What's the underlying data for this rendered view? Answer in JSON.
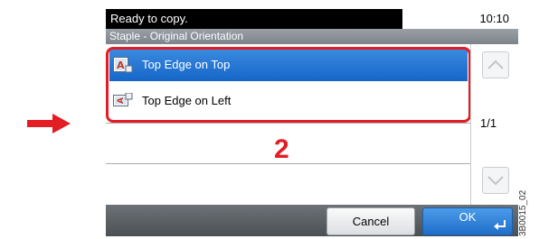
{
  "status": {
    "message": "Ready to copy.",
    "time": "10:10"
  },
  "screen_title": "Staple - Original Orientation",
  "options": [
    {
      "label": "Top Edge on Top",
      "selected": true,
      "icon": "orientation-top-icon"
    },
    {
      "label": "Top Edge on Left",
      "selected": false,
      "icon": "orientation-left-icon"
    }
  ],
  "pagination": {
    "indicator": "1/1"
  },
  "buttons": {
    "cancel": "Cancel",
    "ok": "OK"
  },
  "callout": {
    "step_number": "2"
  },
  "reference_code": "3B0015_02",
  "colors": {
    "selection_blue": "#1567c8",
    "callout_red": "#e31d24",
    "status_black": "#000000",
    "bottom_bar_gray": "#5b6066"
  }
}
